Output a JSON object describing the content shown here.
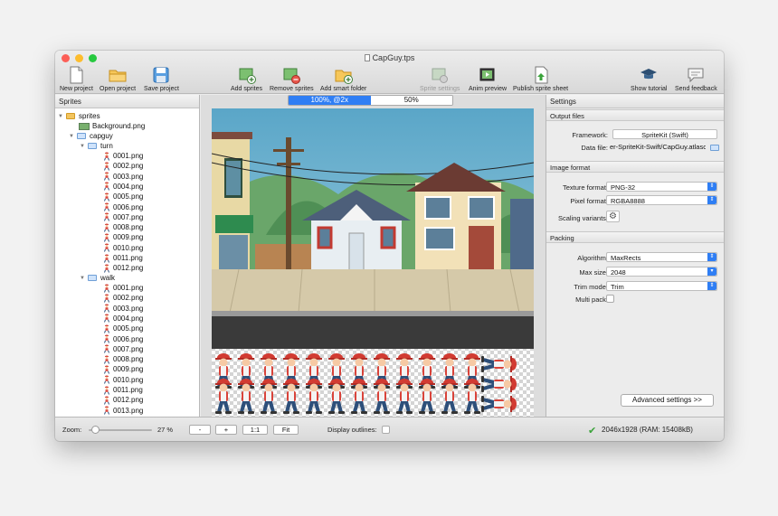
{
  "window": {
    "title": "CapGuy.tps",
    "traffic_colors": {
      "close": "#fc5f57",
      "minimize": "#fdbd2e",
      "maximize": "#27c93f"
    }
  },
  "toolbar": {
    "items": [
      {
        "label": "New project",
        "icon": "new-project-icon"
      },
      {
        "label": "Open project",
        "icon": "open-folder-icon"
      },
      {
        "label": "Save project",
        "icon": "save-disk-icon"
      },
      {
        "label": "Add sprites",
        "icon": "add-sprites-icon"
      },
      {
        "label": "Remove sprites",
        "icon": "remove-sprites-icon"
      },
      {
        "label": "Add smart folder",
        "icon": "add-smart-folder-icon"
      },
      {
        "label": "Sprite settings",
        "icon": "sprite-settings-icon",
        "disabled": true
      },
      {
        "label": "Anim preview",
        "icon": "anim-preview-icon"
      },
      {
        "label": "Publish sprite sheet",
        "icon": "publish-icon"
      },
      {
        "label": "Show tutorial",
        "icon": "graduation-cap-icon"
      },
      {
        "label": "Send feedback",
        "icon": "speech-bubble-icon"
      }
    ]
  },
  "sprites_panel": {
    "title": "Sprites",
    "root": "sprites",
    "background": "Background.png",
    "capguy": "capguy",
    "turn": {
      "name": "turn",
      "files": [
        "0001.png",
        "0002.png",
        "0003.png",
        "0004.png",
        "0005.png",
        "0006.png",
        "0007.png",
        "0008.png",
        "0009.png",
        "0010.png",
        "0011.png",
        "0012.png"
      ]
    },
    "walk": {
      "name": "walk",
      "files": [
        "0001.png",
        "0002.png",
        "0003.png",
        "0004.png",
        "0005.png",
        "0006.png",
        "0007.png",
        "0008.png",
        "0009.png",
        "0010.png",
        "0011.png",
        "0012.png",
        "0013.png"
      ]
    }
  },
  "preview": {
    "zoom_tabs": [
      "100%, @2x",
      "50%"
    ],
    "active_tab": 0
  },
  "settings": {
    "title": "Settings",
    "output_files": {
      "header": "Output files",
      "framework_label": "Framework:",
      "framework_value": "SpriteKit (Swift)",
      "data_file_label": "Data file:",
      "data_file_value": "er-SpriteKit-Swift/CapGuy.atlasc"
    },
    "image_format": {
      "header": "Image format",
      "texture_format_label": "Texture format:",
      "texture_format_value": "PNG-32",
      "pixel_format_label": "Pixel format:",
      "pixel_format_value": "RGBA8888",
      "scaling_label": "Scaling variants:"
    },
    "packing": {
      "header": "Packing",
      "algorithm_label": "Algorithm:",
      "algorithm_value": "MaxRects",
      "max_size_label": "Max size:",
      "max_size_value": "2048",
      "trim_mode_label": "Trim mode:",
      "trim_mode_value": "Trim",
      "multi_pack_label": "Multi pack:"
    },
    "advanced_button": "Advanced settings >>"
  },
  "statusbar": {
    "zoom_label": "Zoom:",
    "zoom_value": "27 %",
    "zoom_fraction": 0.05,
    "btn_minus": "-",
    "btn_plus": "+",
    "btn_one": "1:1",
    "btn_fit": "Fit",
    "display_outlines": "Display outlines:",
    "status": "2046x1928 (RAM: 15408kB)"
  },
  "colors": {
    "accent": "#2f7ef4",
    "ok_green": "#3aa33a"
  }
}
